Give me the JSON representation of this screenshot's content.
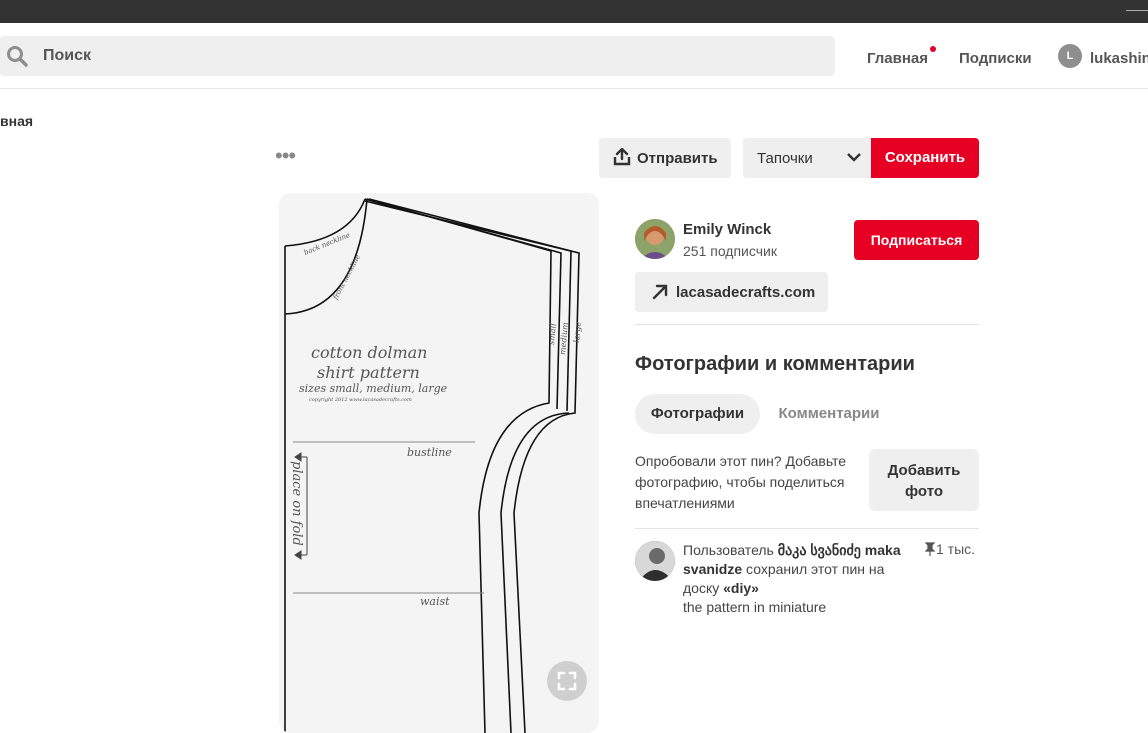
{
  "search": {
    "placeholder": "Поиск"
  },
  "nav": {
    "home": "Главная",
    "subscriptions": "Подписки",
    "user_initial": "L",
    "user_name": "lukashin"
  },
  "breadcrumb": "вная",
  "toolbar": {
    "more": "•••",
    "share_label": "Отправить",
    "board_selected": "Тапочки",
    "save_label": "Сохранить"
  },
  "pin_image": {
    "title_line1": "cotton dolman",
    "title_line2": "shirt pattern",
    "sizes": "sizes small, medium, large",
    "copyright": "copyright 2012 www.lacasadecrafts.com",
    "back_neckline": "back neckline",
    "front_neckline": "front neckline",
    "size_small": "small",
    "size_medium": "medium",
    "size_large": "large",
    "bustline": "bustline",
    "waist": "waist",
    "place_on_fold": "place on fold"
  },
  "author": {
    "name": "Emily Winck",
    "followers": "251 подписчик",
    "follow_label": "Подписаться"
  },
  "source_link": "lacasadecrafts.com",
  "comments_section": {
    "title": "Фотографии и комментарии",
    "tabs": [
      "Фотографии",
      "Комментарии"
    ],
    "tried_text": "Опробовали этот пин? Добавьте фотографию, чтобы поделиться впечатлениями",
    "add_photo_line1": "Добавить",
    "add_photo_line2": "фото"
  },
  "activity": {
    "prefix": "Пользователь",
    "user_name": "მაკა სვანიძე maka svanidze",
    "middle": "сохранил этот пин на доску",
    "board": "«diy»",
    "description": "the pattern in miniature",
    "saves": "1 тыс."
  },
  "colors": {
    "brand_red": "#e60023",
    "topbar": "#333333",
    "button_gray": "#efefef"
  },
  "icons": [
    "search-icon",
    "share-icon",
    "chevron-down-icon",
    "arrow-up-right-icon",
    "expand-icon",
    "pin-icon"
  ]
}
